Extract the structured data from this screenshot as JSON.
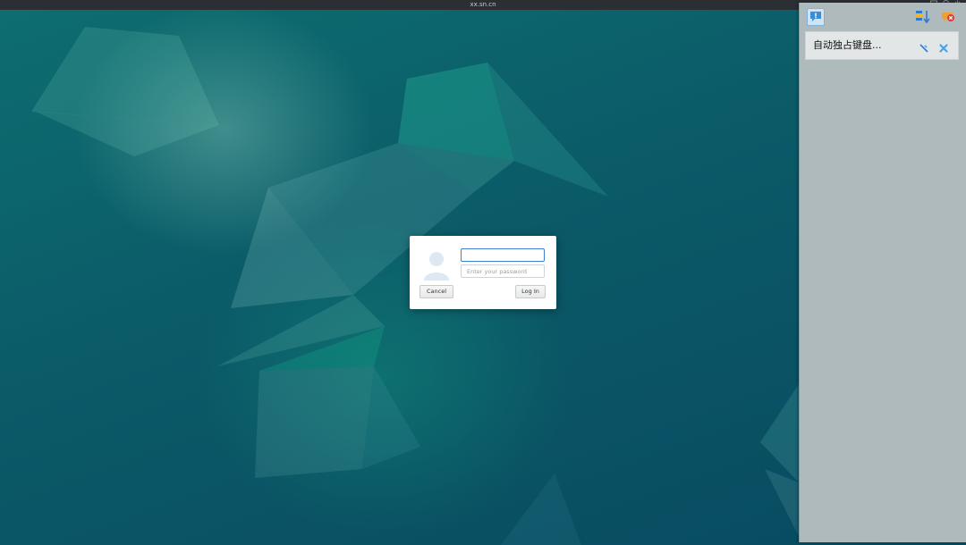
{
  "topbar": {
    "hostname": "xx.sn.cn"
  },
  "login": {
    "username_value": "",
    "password_placeholder": "Enter your password",
    "cancel_label": "Cancel",
    "login_label": "Log In"
  },
  "panel": {
    "notification_text": "自动独占键盘..."
  },
  "colors": {
    "desktop_base": "#0b4f63",
    "panel_bg": "#aebabb",
    "input_focus": "#3d7fd6"
  },
  "icons": {
    "avatar": "user-avatar-icon",
    "messages": "message-alert-icon",
    "sort": "sort-icon",
    "clear_all": "clear-notifications-icon",
    "pin": "pin-icon",
    "close": "close-icon"
  }
}
